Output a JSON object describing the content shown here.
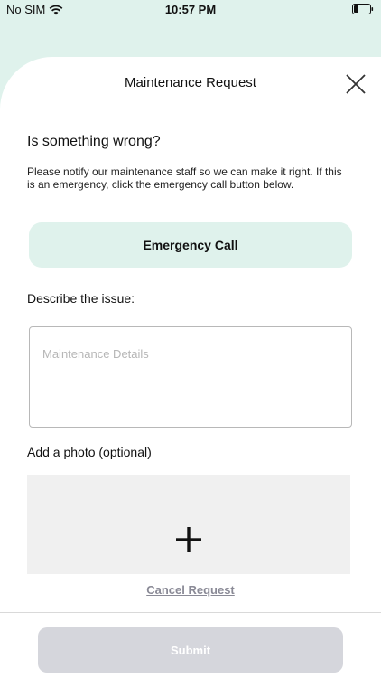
{
  "status_bar": {
    "carrier": "No SIM",
    "time": "10:57 PM",
    "wifi_icon": "wifi-icon",
    "battery_icon": "battery-icon"
  },
  "header": {
    "title": "Maintenance Request",
    "close_icon": "close-icon"
  },
  "intro": {
    "heading": "Is something wrong?",
    "description": "Please notify our maintenance staff so we can make it right. If this is an emergency, click the emergency call button below."
  },
  "emergency": {
    "label": "Emergency Call"
  },
  "issue": {
    "label": "Describe the issue:",
    "placeholder": "Maintenance Details",
    "value": ""
  },
  "photo": {
    "label": "Add a photo (optional)",
    "add_icon": "plus-icon"
  },
  "actions": {
    "cancel_label": "Cancel Request",
    "submit_label": "Submit"
  },
  "colors": {
    "accent": "#dff2ec",
    "submit_disabled": "#d5d6dc",
    "cancel_text": "#8a8a96"
  }
}
